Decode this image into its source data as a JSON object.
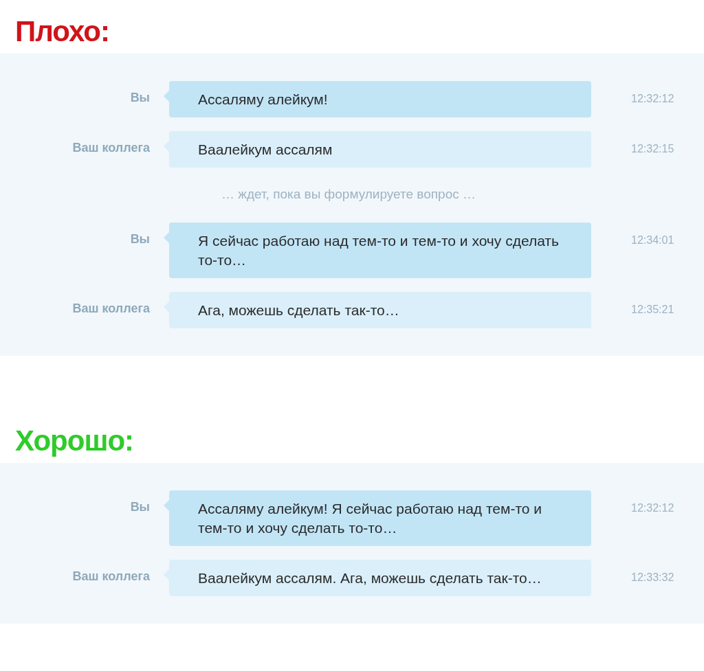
{
  "sections": [
    {
      "heading": "Плохо:",
      "color": "#d0141a",
      "messages": [
        {
          "kind": "message",
          "outgoing": true,
          "sender": "Вы",
          "text": "Ассаляму алейкум!",
          "time": "12:32:12"
        },
        {
          "kind": "message",
          "outgoing": false,
          "sender": "Ваш коллега",
          "text": "Ваалейкум ассалям",
          "time": "12:32:15"
        },
        {
          "kind": "note",
          "text": "… ждет, пока вы формулируете вопрос …"
        },
        {
          "kind": "message",
          "outgoing": true,
          "sender": "Вы",
          "text": "Я сейчас работаю над тем-то и тем-то и хочу сделать то-то…",
          "time": "12:34:01"
        },
        {
          "kind": "message",
          "outgoing": false,
          "sender": "Ваш коллега",
          "text": "Ага, можешь сделать так-то…",
          "time": "12:35:21"
        }
      ]
    },
    {
      "heading": "Хорошо:",
      "color": "#2fcb2a",
      "messages": [
        {
          "kind": "message",
          "outgoing": true,
          "sender": "Вы",
          "text": "Ассаляму алейкум! Я сейчас работаю над тем-то и тем-то и хочу сделать то-то…",
          "time": "12:32:12"
        },
        {
          "kind": "message",
          "outgoing": false,
          "sender": "Ваш коллега",
          "text": "Ваалейкум ассалям. Ага, можешь сделать так-то…",
          "time": "12:33:32"
        }
      ]
    }
  ]
}
